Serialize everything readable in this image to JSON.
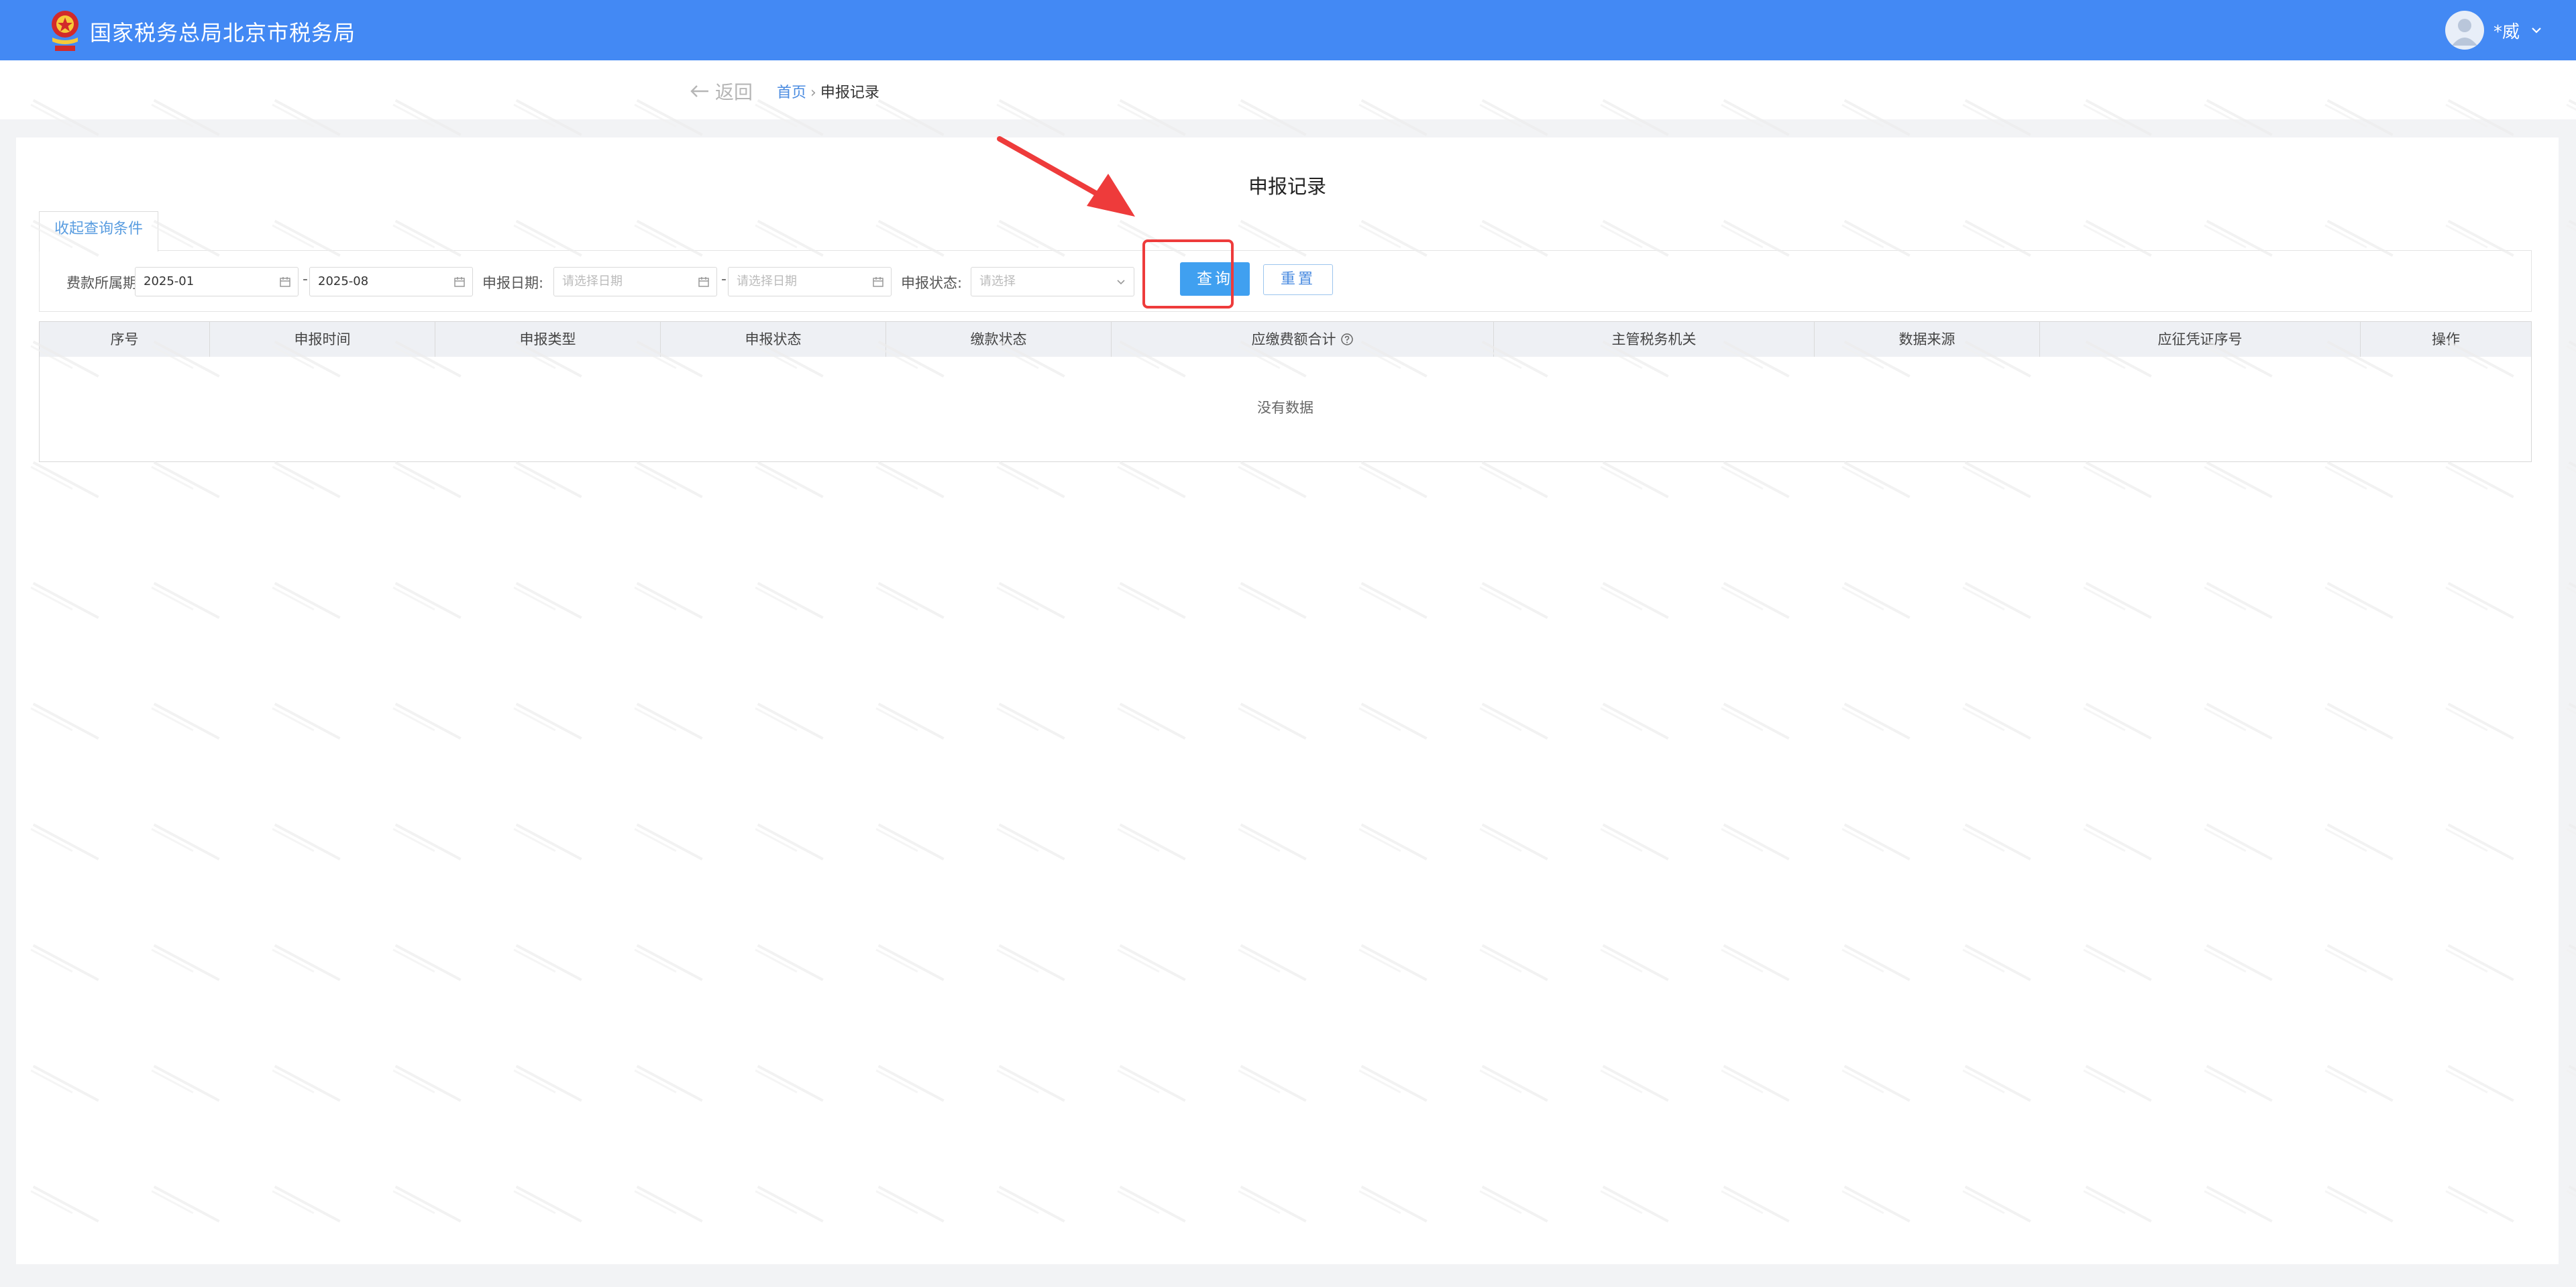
{
  "header": {
    "site_title": "国家税务总局北京市税务局",
    "user_name": "*威",
    "colors": {
      "bar": "#4389f4"
    }
  },
  "nav": {
    "back_label": "返回",
    "breadcrumb": {
      "home": "首页",
      "separator": "›",
      "current": "申报记录"
    }
  },
  "page": {
    "title": "申报记录",
    "collapse_tab": "收起查询条件"
  },
  "filters": {
    "period_label": "费款所属期:",
    "period_start": "2025-01",
    "period_end": "2025-08",
    "range_dash": "-",
    "date_label": "申报日期:",
    "date_start_placeholder": "请选择日期",
    "date_end_placeholder": "请选择日期",
    "status_label": "申报状态:",
    "status_placeholder": "请选择",
    "query_button": "查询",
    "reset_button": "重置"
  },
  "table": {
    "columns": [
      "序号",
      "申报时间",
      "申报类型",
      "申报状态",
      "缴款状态",
      "应缴费额合计",
      "主管税务机关",
      "数据来源",
      "应征凭证序号",
      "操作"
    ],
    "empty_text": "没有数据"
  },
  "annotation": {
    "color": "#ee3b3b"
  }
}
